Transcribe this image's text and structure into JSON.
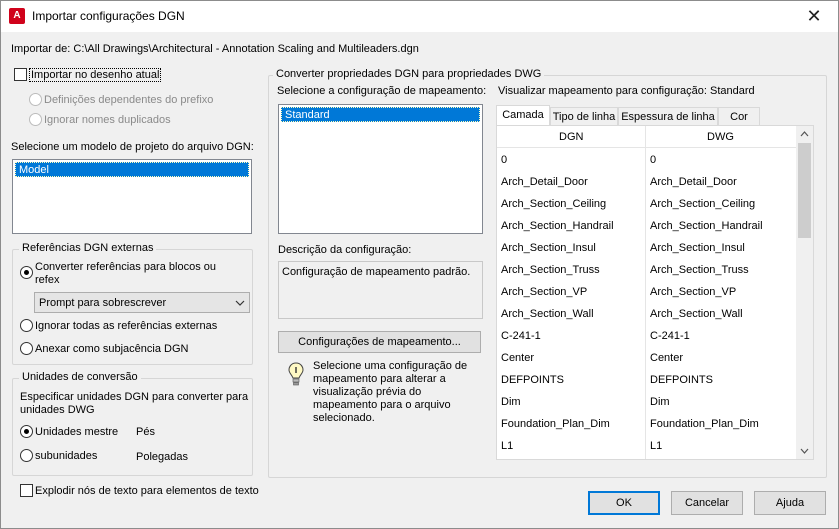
{
  "window": {
    "title": "Importar configurações DGN",
    "close_glyph": "✕"
  },
  "import_from": {
    "label": "Importar de:",
    "path": "C:\\All Drawings\\Architectural - Annotation Scaling and Multileaders.dgn"
  },
  "left": {
    "import_current_drawing": "Importar no desenho atual",
    "prefix_dependent": "Definições dependentes do prefixo",
    "ignore_duplicates": "Ignorar nomes duplicados",
    "seed_label": "Selecione um modelo de projeto do arquivo DGN:",
    "seed_items": [
      "Model"
    ],
    "xref_group": "Referências DGN externas",
    "convert_refs_line1": "Converter referências para blocos ou",
    "convert_refs_line2": "refex",
    "prompt_combo": "Prompt para sobrescrever",
    "ignore_refs": "Ignorar todas as referências externas",
    "attach_underlay": "Anexar como subjacência DGN",
    "units_group": "Unidades de conversão",
    "units_desc_line1": "Especificar unidades DGN para converter para",
    "units_desc_line2": "unidades DWG",
    "master_units": "Unidades mestre",
    "master_value": "Pés",
    "sub_units": "subunidades",
    "sub_value": "Polegadas",
    "explode_text": "Explodir nós de texto para elementos de texto"
  },
  "right": {
    "group_title": "Converter propriedades DGN para propriedades DWG",
    "select_config_label": "Selecione a configuração de  mapeamento:",
    "configs": [
      "Standard"
    ],
    "preview_label": "Visualizar mapeamento para configuração: Standard",
    "desc_label": "Descrição da configuração:",
    "desc_text": "Configuração de mapeamento padrão.",
    "mapping_button": "Configurações de mapeamento...",
    "hint_line1": "Selecione uma configuração de",
    "hint_line2": "mapeamento para alterar a",
    "hint_line3": "visualização prévia do",
    "hint_line4": "mapeamento para o arquivo",
    "hint_line5": "selecionado.",
    "tabs": [
      "Camada",
      "Tipo de linha",
      "Espessura de linha",
      "Cor"
    ],
    "columns": [
      "DGN",
      "DWG"
    ],
    "rows": [
      [
        "0",
        "0"
      ],
      [
        "Arch_Detail_Door",
        "Arch_Detail_Door"
      ],
      [
        "Arch_Section_Ceiling",
        "Arch_Section_Ceiling"
      ],
      [
        "Arch_Section_Handrail",
        "Arch_Section_Handrail"
      ],
      [
        "Arch_Section_Insul",
        "Arch_Section_Insul"
      ],
      [
        "Arch_Section_Truss",
        "Arch_Section_Truss"
      ],
      [
        "Arch_Section_VP",
        "Arch_Section_VP"
      ],
      [
        "Arch_Section_Wall",
        "Arch_Section_Wall"
      ],
      [
        "C-241-1",
        "C-241-1"
      ],
      [
        "Center",
        "Center"
      ],
      [
        "DEFPOINTS",
        "DEFPOINTS"
      ],
      [
        "Dim",
        "Dim"
      ],
      [
        "Foundation_Plan_Dim",
        "Foundation_Plan_Dim"
      ],
      [
        "L1",
        "L1"
      ]
    ]
  },
  "footer": {
    "ok": "OK",
    "cancel": "Cancelar",
    "help": "Ajuda"
  }
}
